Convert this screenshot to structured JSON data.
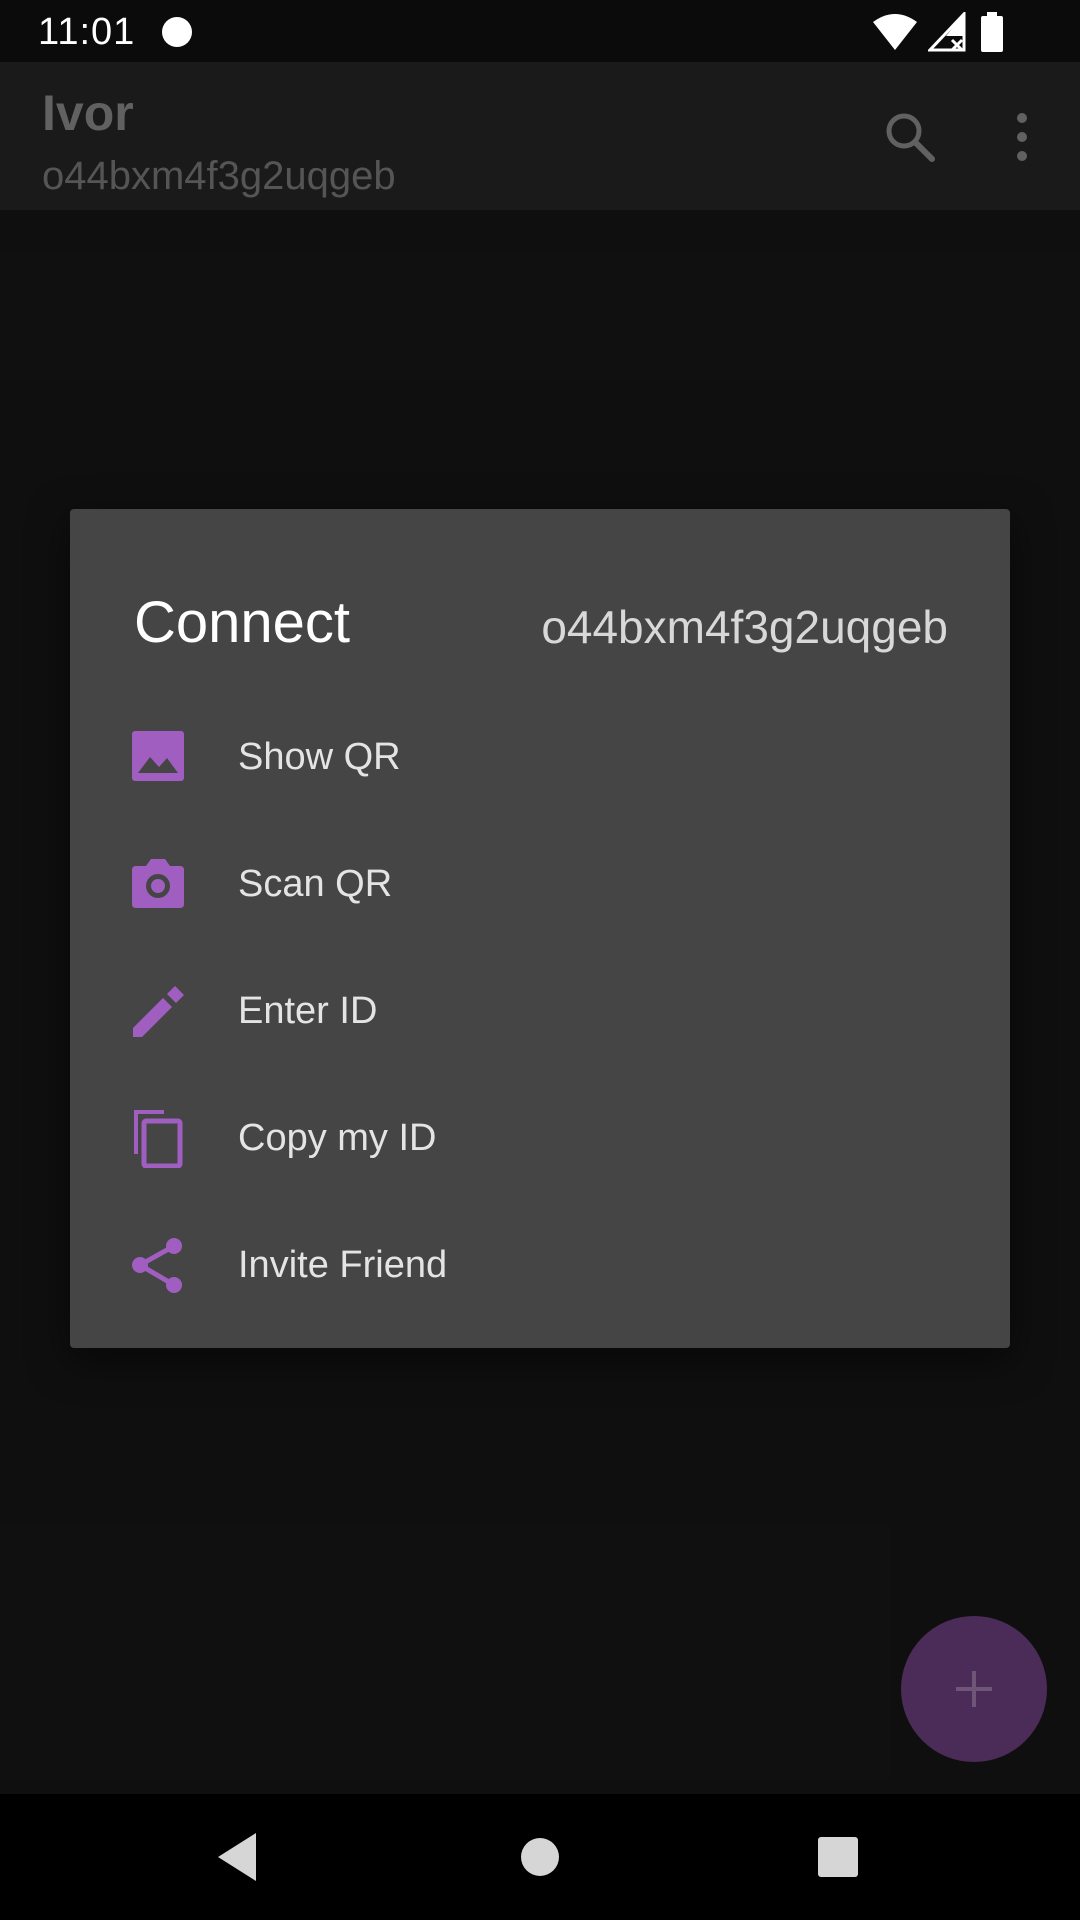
{
  "status_bar": {
    "time": "11:01"
  },
  "app_bar": {
    "title": "Ivor",
    "subtitle": "o44bxm4f3g2uqgeb",
    "icons": [
      "search-icon",
      "more-vert-icon"
    ]
  },
  "dialog": {
    "title": "Connect",
    "user_id": "o44bxm4f3g2uqgeb",
    "items": [
      {
        "label": "Show QR",
        "icon": "image-icon"
      },
      {
        "label": "Scan QR",
        "icon": "camera-icon"
      },
      {
        "label": "Enter ID",
        "icon": "pencil-icon"
      },
      {
        "label": "Copy my ID",
        "icon": "copy-icon"
      },
      {
        "label": "Invite Friend",
        "icon": "share-icon"
      }
    ]
  },
  "fab": {
    "icon": "plus-icon"
  },
  "nav_bar": {
    "icons": [
      "back-icon",
      "home-icon",
      "recents-icon"
    ]
  },
  "colors": {
    "accent": "#a05fc0",
    "dialog_bg": "#454545",
    "background": "#111111",
    "fab_dimmed": "#4b2b57"
  }
}
